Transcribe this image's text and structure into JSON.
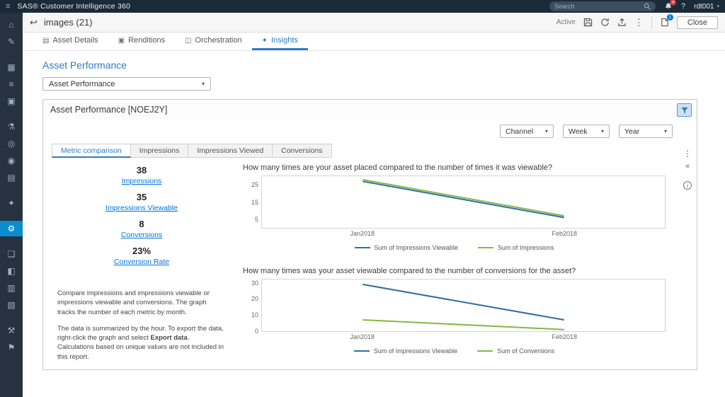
{
  "topbar": {
    "brand": "SAS® Customer Intelligence 360",
    "search_placeholder": "Search",
    "notification_count": "4",
    "user": "rdt001"
  },
  "sidebar": {
    "items": [
      {
        "name": "home",
        "glyph": "⌂"
      },
      {
        "name": "compose",
        "glyph": "✎"
      },
      {
        "name": "calendar",
        "glyph": "▦",
        "gap": true
      },
      {
        "name": "tasks",
        "glyph": "≡"
      },
      {
        "name": "assets",
        "glyph": "▣"
      },
      {
        "name": "experiments",
        "glyph": "⚗",
        "gap": true
      },
      {
        "name": "audiences",
        "glyph": "◎"
      },
      {
        "name": "goals",
        "glyph": "◉"
      },
      {
        "name": "data",
        "glyph": "▤"
      },
      {
        "name": "ideas",
        "glyph": "✦",
        "gap": true
      },
      {
        "name": "settings",
        "glyph": "⚙",
        "active": true,
        "gap": true
      },
      {
        "name": "portfolio",
        "glyph": "❏",
        "gap": true
      },
      {
        "name": "reports",
        "glyph": "◧"
      },
      {
        "name": "library",
        "glyph": "▥"
      },
      {
        "name": "documents",
        "glyph": "▧"
      },
      {
        "name": "tools",
        "glyph": "⚒",
        "gap": true
      },
      {
        "name": "announcements",
        "glyph": "⚑"
      }
    ]
  },
  "toolbar": {
    "title": "images (21)",
    "status_label": "Active",
    "page_badge": "1",
    "close_label": "Close"
  },
  "tabs": [
    {
      "label": "Asset Details",
      "icon": "▤"
    },
    {
      "label": "Renditions",
      "icon": "▣"
    },
    {
      "label": "Orchestration",
      "icon": "◫"
    },
    {
      "label": "Insights",
      "icon": "✦"
    }
  ],
  "report": {
    "heading": "Asset Performance",
    "selector_value": "Asset Performance",
    "panel_title": "Asset Performance [NOEJ2Y]",
    "filters": [
      "Channel",
      "Week",
      "Year"
    ],
    "inner_tabs": [
      "Metric comparison",
      "Impressions",
      "Impressions Viewed",
      "Conversions"
    ],
    "metrics": [
      {
        "value": "38",
        "label": "Impressions"
      },
      {
        "value": "35",
        "label": "Impressions Viewable"
      },
      {
        "value": "8",
        "label": "Conversions"
      },
      {
        "value": "23%",
        "label": "Conversion Rate"
      }
    ],
    "description_1": "Compare impressions and impressions viewable or impressions viewable and conversions. The graph tracks the number of each metric by month.",
    "description_2_pre": "The data is summarized by the hour. To export the data, right-click the graph and select ",
    "description_2_bold": "Export data",
    "description_2_post": ". Calculations based on unique values are not included in this report."
  },
  "colors": {
    "accent": "#2f7cc0",
    "link": "#0073e0",
    "line_blue": "#2e6da4",
    "line_green": "#86b941"
  },
  "chart_data": [
    {
      "type": "line",
      "title": "How many times are your asset placed compared to the number of times it was viewable?",
      "x": [
        "Jan2018",
        "Feb2018"
      ],
      "series": [
        {
          "name": "Sum of Impressions Viewable",
          "color": "#2e6da4",
          "values": [
            27,
            6
          ]
        },
        {
          "name": "Sum of Impressions",
          "color": "#86b941",
          "values": [
            28,
            7
          ]
        }
      ],
      "ylim": [
        0,
        30
      ],
      "yticks": [
        5,
        15,
        25
      ],
      "grid": false,
      "legend_position": "bottom"
    },
    {
      "type": "line",
      "title": "How many times was your asset viewable compared to the number of conversions for the asset?",
      "x": [
        "Jan2018",
        "Feb2018"
      ],
      "series": [
        {
          "name": "Sum of Impressions Viewable",
          "color": "#2e6da4",
          "values": [
            29,
            7
          ]
        },
        {
          "name": "Sum of Conversions",
          "color": "#86b941",
          "values": [
            7,
            1
          ]
        }
      ],
      "ylim": [
        0,
        32
      ],
      "yticks": [
        0,
        10,
        20,
        30
      ],
      "grid": false,
      "legend_position": "bottom"
    }
  ]
}
